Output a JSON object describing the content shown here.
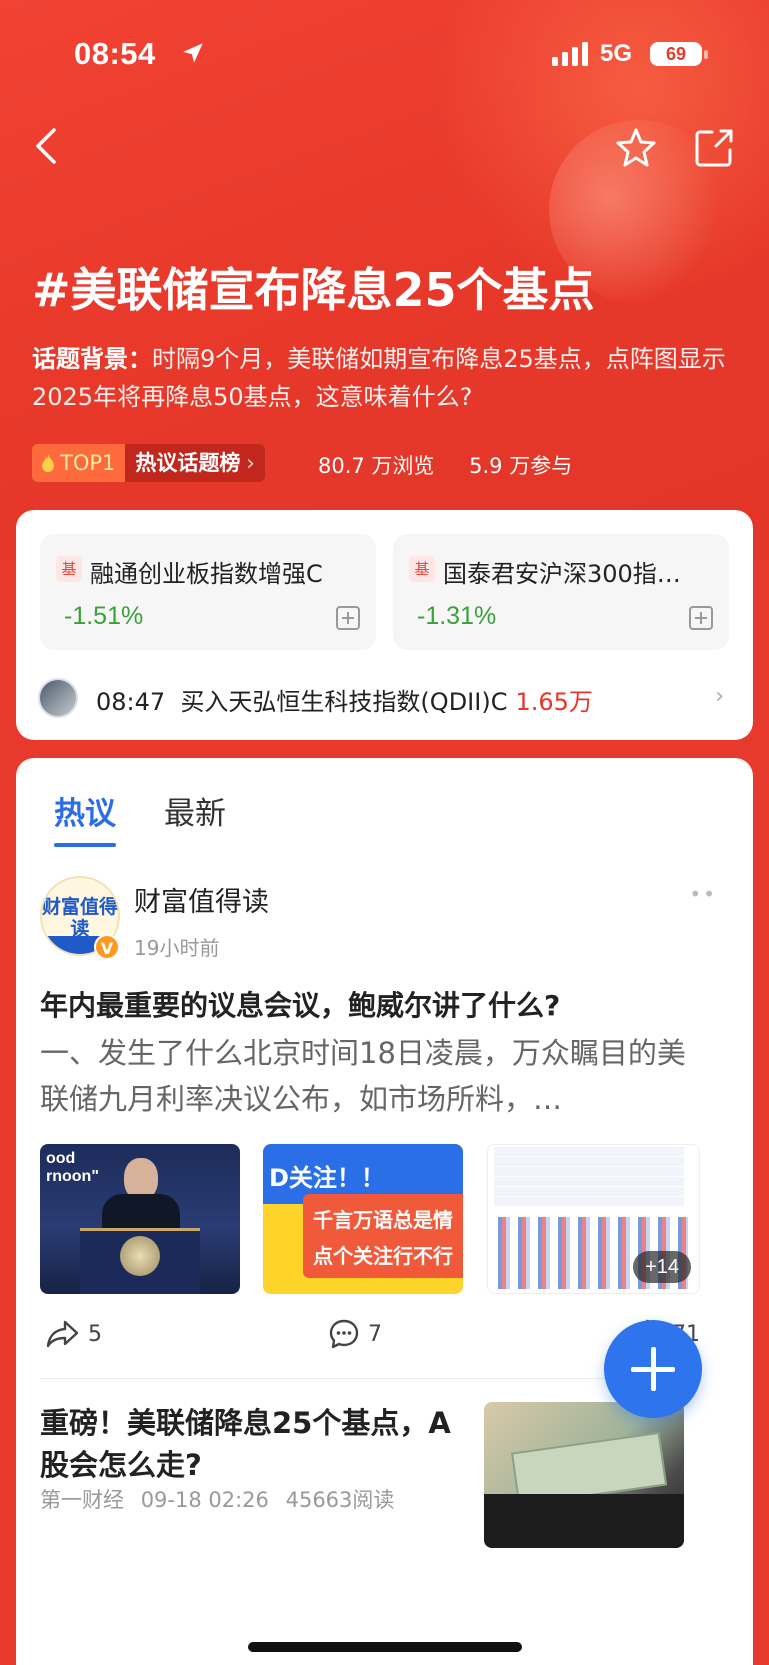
{
  "status_bar": {
    "time": "08:54",
    "network": "5G",
    "battery": "69"
  },
  "nav": {
    "back": "back-icon",
    "favorite": "star-icon",
    "share": "share-icon"
  },
  "topic": {
    "title": "#美联储宣布降息25个基点",
    "desc_label": "话题背景：",
    "desc_text": "时隔9个月，美联储如期宣布降息25基点，点阵图显示2025年将再降息50基点，这意味着什么?",
    "rank_badge": "TOP1",
    "rank_list": "热议话题榜",
    "views": "80.7 万浏览",
    "participants": "5.9 万参与"
  },
  "funds": [
    {
      "tag": "基",
      "name": "融通创业板指数增强C",
      "change": "-1.51%"
    },
    {
      "tag": "基",
      "name": "国泰君安沪深300指…",
      "change": "-1.31%"
    }
  ],
  "trade": {
    "time": "08:47",
    "action": "买入天弘恒生科技指数(QDII)C",
    "amount": "1.65万"
  },
  "tabs": [
    {
      "label": "热议",
      "active": true
    },
    {
      "label": "最新",
      "active": false
    }
  ],
  "post1": {
    "avatar_text": "财富值得读",
    "author": "财富值得读",
    "time": "19小时前",
    "title": "年内最重要的议息会议，鲍威尔讲了什么?",
    "excerpt": "一、发生了什么北京时间18日凌晨，万众瞩目的美联储九月利率决议公布，如市场所料，…",
    "thumb1_caption": "ood\nrnoon\"",
    "thumb2_line1": "D关注！！",
    "thumb2_line2": "千言万语总是情",
    "thumb2_line3": "点个关注行不行",
    "more_images": "+14",
    "shares": "5",
    "comments": "7",
    "likes": "71"
  },
  "post2": {
    "title": "重磅！美联储降息25个基点，A股会怎么走?",
    "source": "第一财经",
    "datetime": "09-18 02:26",
    "reads": "45663阅读"
  },
  "colors": {
    "brand_red": "#e8392b",
    "accent_blue": "#2b6de8",
    "down_green": "#3aa13a",
    "amount_red": "#e9342a"
  }
}
